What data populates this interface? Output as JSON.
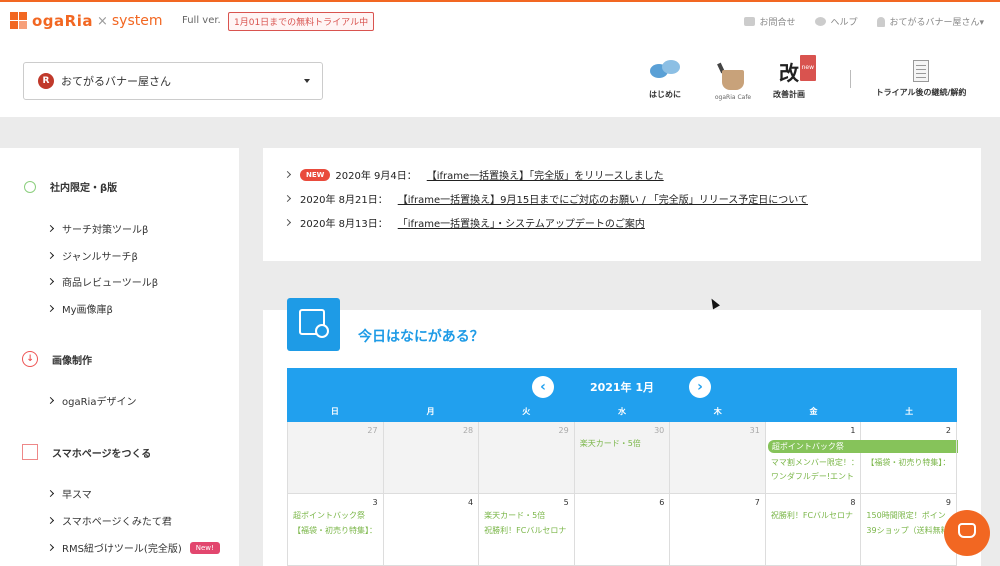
{
  "header": {
    "logo_brand": "ogaRia",
    "logo_x": "×",
    "logo_system": "system",
    "version": "Full ver.",
    "trial_badge": "1月01日までの無料トライアル中",
    "links": [
      "お問合せ",
      "ヘルプ",
      "おてがるバナー屋さん▾"
    ],
    "shop": {
      "initial": "R",
      "name": "おてがるバナー屋さん"
    },
    "nav": {
      "hajime": "はじめに",
      "cafe_label": "ogaRia Cafe",
      "kaizen_glyph": "改",
      "kaizen_new": "new",
      "kaizen": "改善計画",
      "trial_after": "トライアル後の継続/解約"
    }
  },
  "sidebar": {
    "sections": [
      {
        "title": "社内限定・β版",
        "icon": "planet-icon",
        "items": [
          "サーチ対策ツールβ",
          "ジャンルサーチβ",
          "商品レビューツールβ",
          "My画像庫β"
        ]
      },
      {
        "title": "画像制作",
        "icon": "download-icon",
        "items": [
          "ogaRiaデザイン"
        ]
      },
      {
        "title": "スマホページをつくる",
        "icon": "phone-icon",
        "items": [
          "早スマ",
          "スマホページくみたて君",
          "RMS紐づけツール(完全版)"
        ]
      }
    ],
    "new_pill": "New!"
  },
  "news": {
    "new_badge": "NEW",
    "items": [
      {
        "date": "2020年 9月4日：",
        "title": "【iframe一括置換え】「完全版」をリリースしました"
      },
      {
        "date": "2020年 8月21日：",
        "title": "【iframe一括置換え】9月15日までにご対応のお願い / 「完全版」リリース予定日について"
      },
      {
        "date": "2020年 8月13日：",
        "title": "「iframe一括置換え」・システムアップデートのご案内"
      }
    ]
  },
  "calendar": {
    "title": "今日はなにがある？",
    "month": "2021年 1月",
    "prev": "‹",
    "next": "›",
    "dows": [
      "日",
      "月",
      "火",
      "水",
      "木",
      "金",
      "土"
    ],
    "week1": [
      {
        "d": "27",
        "out": true,
        "events": []
      },
      {
        "d": "28",
        "out": true,
        "events": []
      },
      {
        "d": "29",
        "out": true,
        "events": []
      },
      {
        "d": "30",
        "out": true,
        "events": [
          "楽天カード・5倍"
        ]
      },
      {
        "d": "31",
        "out": true,
        "events": []
      },
      {
        "d": "1",
        "out": false,
        "events": [
          "ママ割メンバー限定！：",
          "ワンダフルデー!エント"
        ]
      },
      {
        "d": "2",
        "out": false,
        "events": [
          "【福袋・初売り特集】："
        ]
      }
    ],
    "week1_bar": "超ポイントバック祭",
    "week2": [
      {
        "d": "3",
        "events": [
          "超ポイントバック祭",
          "【福袋・初売り特集】："
        ]
      },
      {
        "d": "4",
        "events": []
      },
      {
        "d": "5",
        "events": [
          "楽天カード・5倍",
          "祝勝利！FCバルセロナ"
        ]
      },
      {
        "d": "6",
        "events": []
      },
      {
        "d": "7",
        "events": []
      },
      {
        "d": "8",
        "events": [
          "祝勝利！FCバルセロナ"
        ]
      },
      {
        "d": "9",
        "events": [
          "150時間限定！ポイン",
          "39ショップ（送料無料"
        ]
      }
    ]
  }
}
